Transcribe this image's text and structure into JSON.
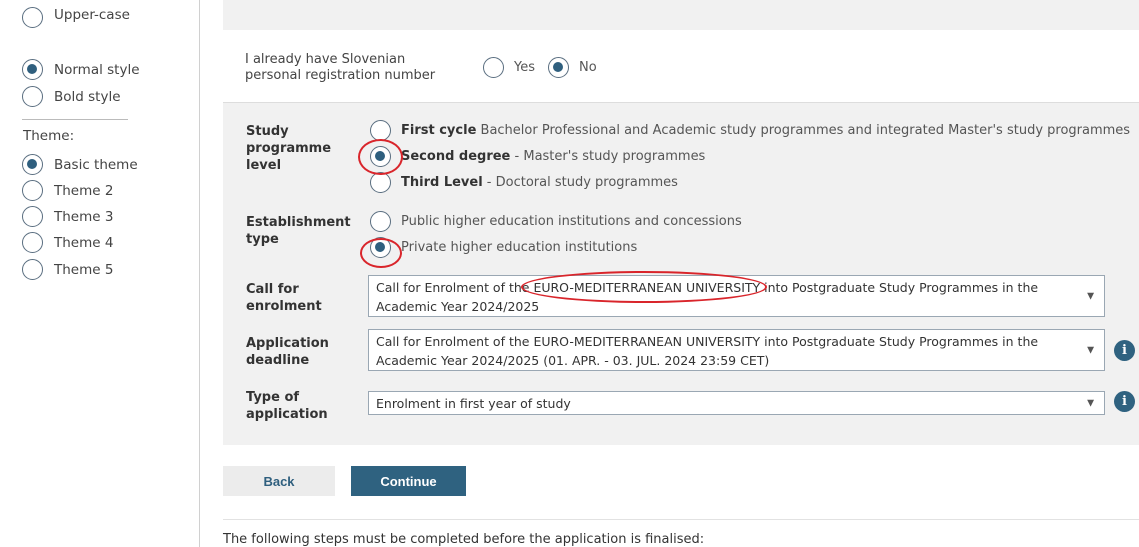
{
  "sidebar": {
    "case_options": [
      {
        "label": "Upper-case",
        "checked": false
      }
    ],
    "style_options": [
      {
        "label": "Normal style",
        "checked": true
      },
      {
        "label": "Bold style",
        "checked": false
      }
    ],
    "theme_heading": "Theme:",
    "theme_options": [
      {
        "label": "Basic theme",
        "checked": true
      },
      {
        "label": "Theme 2",
        "checked": false
      },
      {
        "label": "Theme 3",
        "checked": false
      },
      {
        "label": "Theme 4",
        "checked": false
      },
      {
        "label": "Theme 5",
        "checked": false
      }
    ]
  },
  "registration": {
    "question": "I already have Slovenian personal registration number",
    "yes": "Yes",
    "no": "No",
    "selected": "No"
  },
  "study_level": {
    "label": "Study programme level",
    "options": [
      {
        "bold": "First cycle",
        "text": " Bachelor Professional and Academic study programmes and integrated Master's study programmes",
        "checked": false
      },
      {
        "bold": "Second degree",
        "text": " - Master's study programmes",
        "checked": true
      },
      {
        "bold": "Third Level",
        "text": " - Doctoral study programmes",
        "checked": false
      }
    ]
  },
  "establishment": {
    "label": "Establishment type",
    "options": [
      {
        "text": "Public higher education institutions and concessions",
        "checked": false
      },
      {
        "text": "Private higher education institutions",
        "checked": true
      }
    ]
  },
  "call": {
    "label": "Call for enrolment",
    "value": "Call for Enrolment of the EURO-MEDITERRANEAN UNIVERSITY into Postgraduate Study Programmes in the Academic Year 2024/2025"
  },
  "deadline": {
    "label": "Application deadline",
    "value": "Call for Enrolment of the EURO-MEDITERRANEAN UNIVERSITY into Postgraduate Study Programmes in the Academic Year 2024/2025 (01. APR. - 03. JUL. 2024 23:59 CET)"
  },
  "app_type": {
    "label": "Type of application",
    "value": "Enrolment in first year of study"
  },
  "buttons": {
    "back": "Back",
    "continue": "Continue"
  },
  "footer": "The following steps must be completed before the application is finalised:",
  "colors": {
    "accent": "#2f6280",
    "annotation": "#d9252b",
    "panel": "#f1f1f1"
  },
  "icons": {
    "info": "info-icon",
    "caret": "chevron-down-icon"
  }
}
